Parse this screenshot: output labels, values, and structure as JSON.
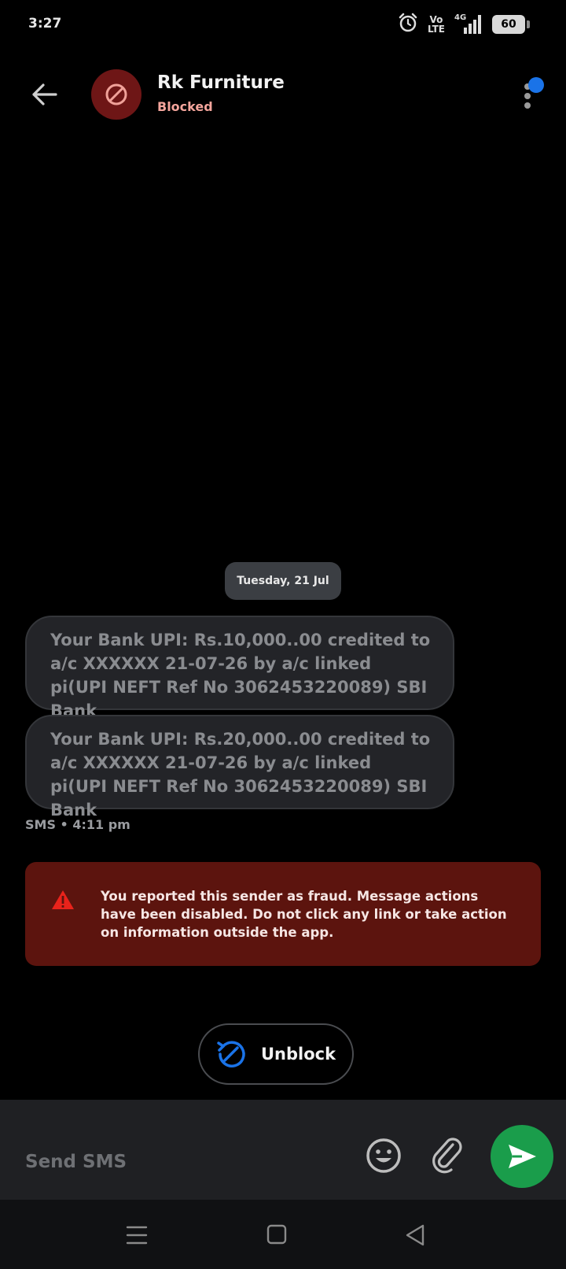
{
  "status_bar": {
    "time": "3:27",
    "volte_line1": "Vo",
    "volte_line2": "LTE",
    "network": "4G",
    "battery": "60"
  },
  "header": {
    "contact_name": "Rk Furniture",
    "contact_status": "Blocked"
  },
  "conversation": {
    "date_label": "Tuesday, 21 Jul",
    "messages": [
      {
        "text": "Your Bank UPI: Rs.10,000..00 credited to a/c XXXXXX 21-07-26 by a/c linked pi(UPI NEFT Ref No 3062453220089) SBI Bank"
      },
      {
        "text": "Your Bank UPI: Rs.20,000..00 credited to a/c XXXXXX 21-07-26 by a/c linked pi(UPI NEFT Ref No 3062453220089) SBI Bank"
      }
    ],
    "meta": "SMS • 4:11 pm"
  },
  "warning": {
    "text": "You reported this sender as fraud. Message actions have been disabled. Do not click any link or take action on information outside the app."
  },
  "unblock": {
    "label": "Unblock"
  },
  "compose": {
    "placeholder": "Send SMS"
  },
  "colors": {
    "blocked_avatar": "#6e1616",
    "blocked_text": "#f4a59c",
    "warning_bg": "#5c140e",
    "send_button": "#1a9d4b",
    "accent_blue": "#1a73e8"
  }
}
